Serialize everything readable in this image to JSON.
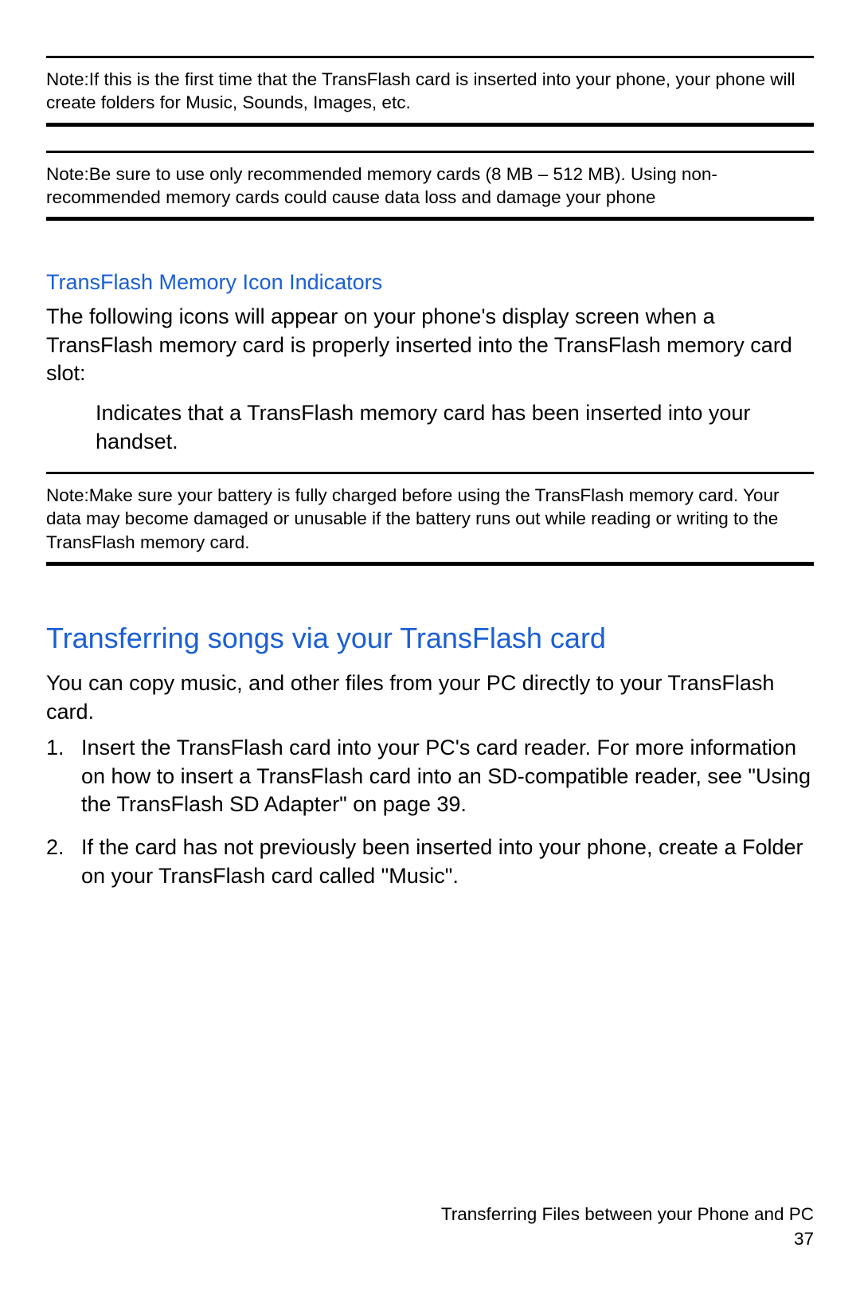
{
  "notes": {
    "n1_prefix": "Note:",
    "n1_text": "If this is the first time that the TransFlash card is inserted into your phone, your phone will create folders for Music, Sounds, Images, etc.",
    "n2_prefix": "Note:",
    "n2_text": "Be sure to use only recommended memory cards (8 MB – 512 MB). Using non-recommended memory cards could cause data loss and damage your phone",
    "n3_prefix": "Note:",
    "n3_text": "Make sure your battery is fully charged before using the TransFlash memory card. Your data may become damaged or unusable if the battery runs out while reading or writing to the TransFlash memory card."
  },
  "indicators": {
    "heading": "TransFlash Memory Icon Indicators",
    "intro": "The following icons will appear on your phone's display screen when a TransFlash memory card is properly inserted into the TransFlash memory card slot:",
    "item1": "Indicates that a TransFlash memory card has been inserted into your handset."
  },
  "transfer": {
    "heading": "Transferring songs via your TransFlash card",
    "intro": "You can copy music, and other files from your PC directly to your TransFlash card.",
    "steps": [
      "Insert the TransFlash card into your PC's card reader. For more information on how to insert a TransFlash card into an SD-compatible reader, see \"Using the TransFlash SD Adapter\" on page 39.",
      "If the card has not previously been inserted into your phone, create a Folder on your TransFlash card called \"Music\"."
    ]
  },
  "footer": {
    "chapter": "Transferring Files between your Phone and PC",
    "page": "37"
  }
}
